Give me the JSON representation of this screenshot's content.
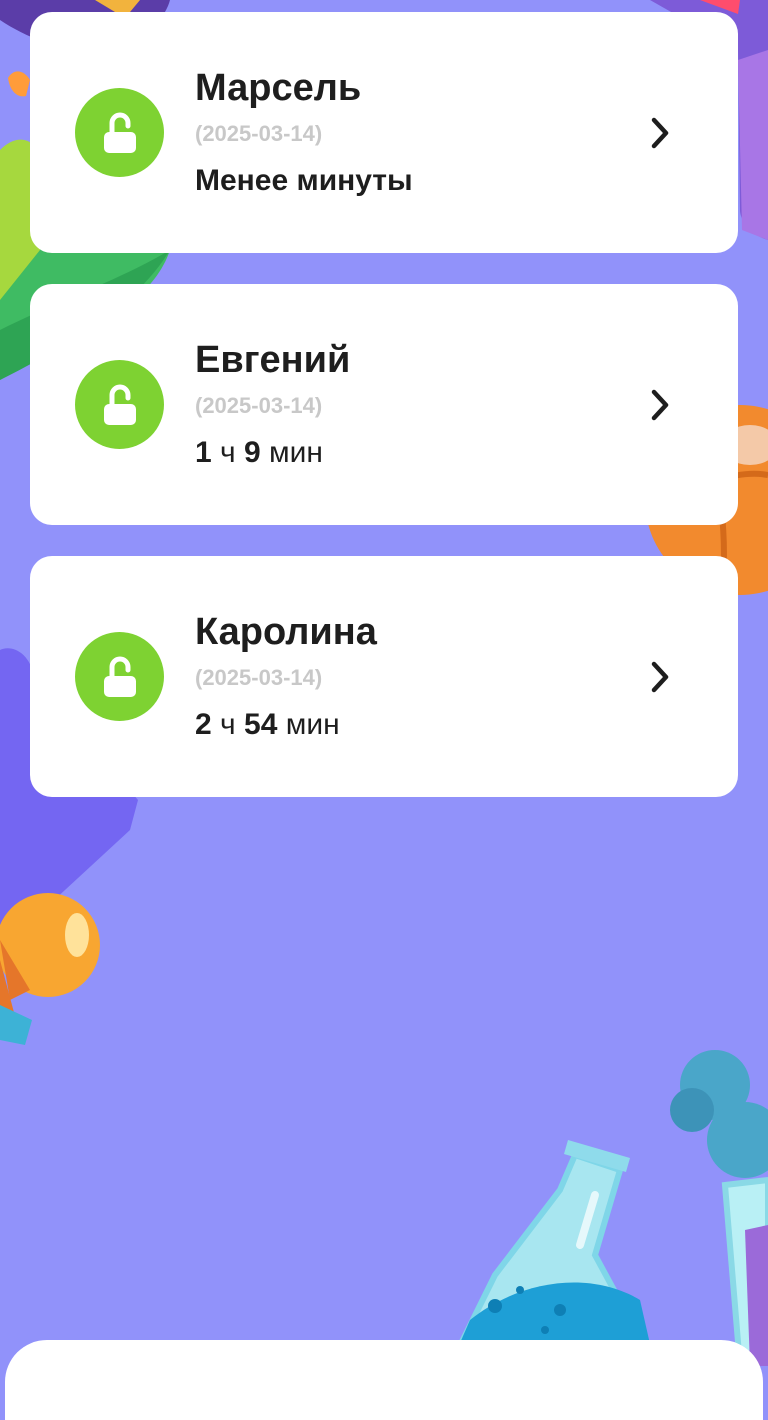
{
  "colors": {
    "background": "#9192fa",
    "card": "#ffffff",
    "lock_badge": "#7ed232",
    "name_text": "#1e1e1e",
    "date_text": "#c8c8c8"
  },
  "sessions": [
    {
      "name": "Марсель",
      "date": "(2025-03-14)",
      "duration_text": "Менее минуты",
      "status_icon": "unlocked-padlock-icon",
      "action_icon": "chevron-right-icon"
    },
    {
      "name": "Евгений",
      "date": "(2025-03-14)",
      "hours": "1",
      "hours_unit": "ч",
      "minutes": "9",
      "minutes_unit": "мин",
      "status_icon": "unlocked-padlock-icon",
      "action_icon": "chevron-right-icon"
    },
    {
      "name": "Каролина",
      "date": "(2025-03-14)",
      "hours": "2",
      "hours_unit": "ч",
      "minutes": "54",
      "minutes_unit": "мин",
      "status_icon": "unlocked-padlock-icon",
      "action_icon": "chevron-right-icon"
    }
  ]
}
